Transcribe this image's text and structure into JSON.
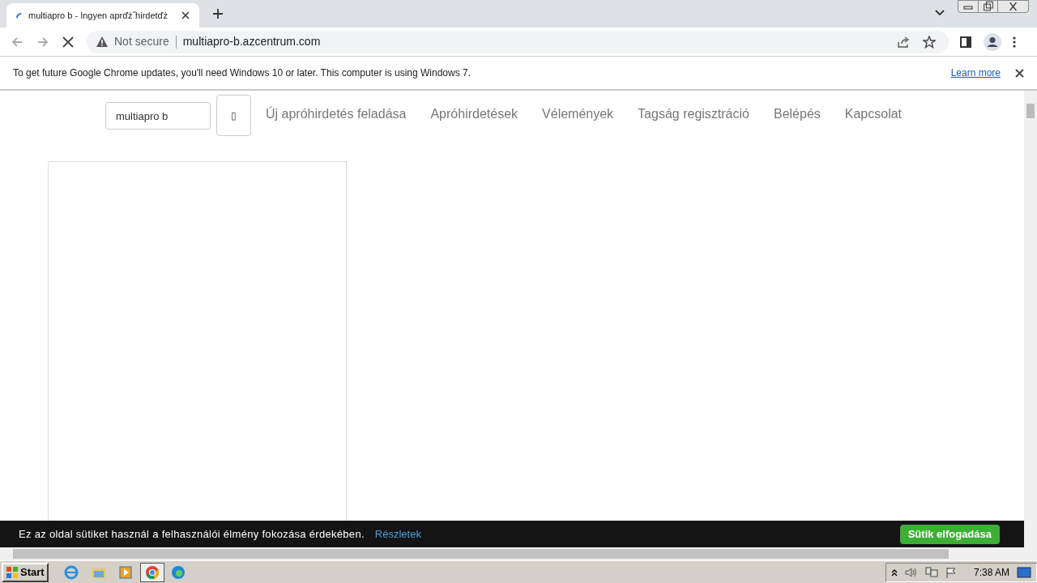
{
  "browser": {
    "tab_title": "multiapro b - Ingyen aprďż˝hirdetďż",
    "address": {
      "security": "Not secure",
      "url": "multiapro-b.azcentrum.com"
    }
  },
  "infobar": {
    "message": "To get future Google Chrome updates, you'll need Windows 10 or later. This computer is using Windows 7.",
    "link": "Learn more"
  },
  "page": {
    "search": {
      "value": "multiapro b",
      "button": "▯"
    },
    "nav": [
      "Új apróhirdetés feladása",
      "Apróhirdetések",
      "Vélemények",
      "Tagság regisztráció",
      "Belépés",
      "Kapcsolat"
    ]
  },
  "cookie_banner": {
    "message": "Ez az oldal sütiket használ a felhasználói élmény fokozása érdekében.",
    "link": "Részletek",
    "button": "Sütik elfogadása"
  },
  "taskbar": {
    "start": "Start",
    "clock": "7:38 AM"
  }
}
